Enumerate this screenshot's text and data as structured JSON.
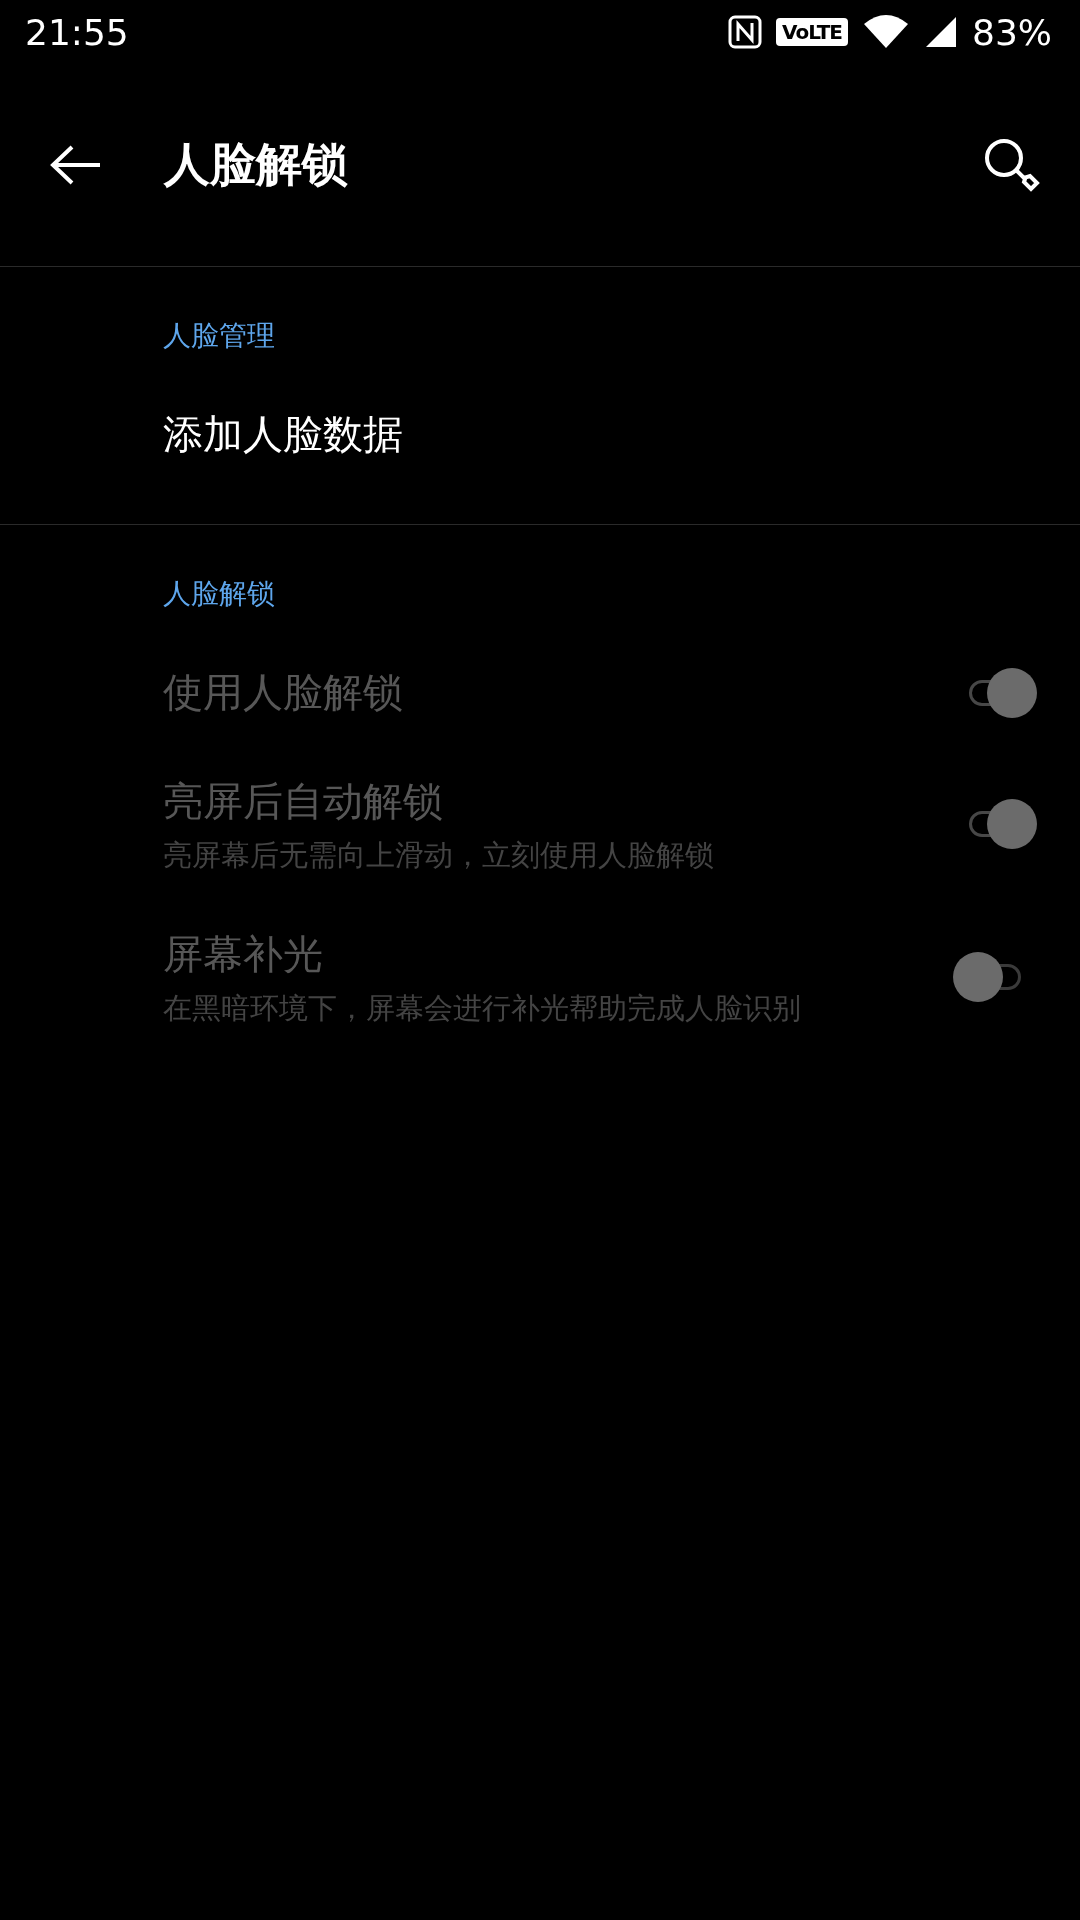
{
  "status_bar": {
    "time": "21:55",
    "volte": "VoLTE",
    "battery": "83%"
  },
  "app_bar": {
    "title": "人脸解锁"
  },
  "sections": [
    {
      "header": "人脸管理",
      "items": [
        {
          "kind": "link",
          "title": "添加人脸数据",
          "disabled": false
        }
      ]
    },
    {
      "header": "人脸解锁",
      "items": [
        {
          "kind": "switch",
          "title": "使用人脸解锁",
          "disabled": true,
          "on": true
        },
        {
          "kind": "switch",
          "title": "亮屏后自动解锁",
          "subtitle": "亮屏幕后无需向上滑动，立刻使用人脸解锁",
          "disabled": true,
          "on": true
        },
        {
          "kind": "switch",
          "title": "屏幕补光",
          "subtitle": "在黑暗环境下，屏幕会进行补光帮助完成人脸识别",
          "disabled": true,
          "on": false
        }
      ]
    }
  ]
}
